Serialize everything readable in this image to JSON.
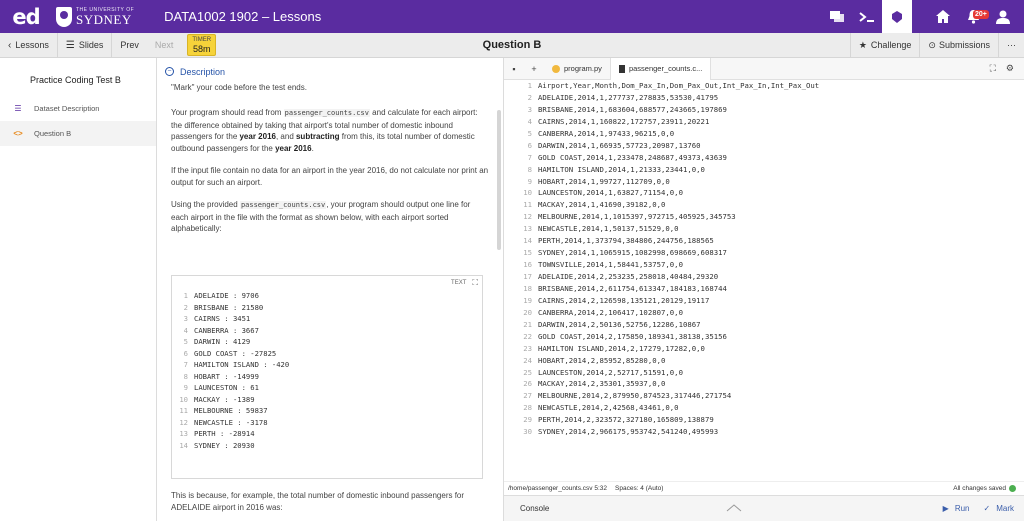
{
  "topbar": {
    "logo": "ed",
    "brand_sub": "THE UNIVERSITY OF",
    "brand_main": "SYDNEY",
    "course": "DATA1002 1902 – Lessons",
    "notif_count": "20+"
  },
  "nav": {
    "lessons": "Lessons",
    "slides": "Slides",
    "prev": "Prev",
    "next": "Next",
    "timer_label": "TIMER",
    "timer_value": "58m",
    "question_title": "Question B",
    "challenge": "Challenge",
    "submissions": "Submissions",
    "more": "···"
  },
  "sidebar": {
    "title": "Practice Coding Test B",
    "items": [
      {
        "label": "Dataset Description"
      },
      {
        "label": "Question B"
      }
    ]
  },
  "description": {
    "header": "Description",
    "cut_line": "\"Mark\" your code before the test ends.",
    "p1_a": "Your program should read from ",
    "p1_code": "passenger_counts.csv",
    "p1_b": " and calculate for each airport: the difference obtained by taking that airport's total number of domestic inbound passengers for the ",
    "p1_year1": "year 2016",
    "p1_c": ", and ",
    "p1_sub": "subtracting",
    "p1_d": " from this, its total number of domestic outbound passengers for the ",
    "p1_year2": "year 2016",
    "p1_e": ".",
    "p2": "If the input file contain no data for an airport in the year 2016, do not calculate nor print an output for such an airport.",
    "p3_a": "Using the provided ",
    "p3_code": "passenger_counts.csv",
    "p3_b": ", your program should output one line for each airport in the file with the format as shown below, with each airport sorted alphabetically:",
    "output_label": "TEXT",
    "output_lines": [
      "ADELAIDE : 9706",
      "BRISBANE : 21580",
      "CAIRNS : 3451",
      "CANBERRA : 3667",
      "DARWIN : 4129",
      "GOLD COAST : -27825",
      "HAMILTON ISLAND : -420",
      "HOBART : -14999",
      "LAUNCESTON : 61",
      "MACKAY : -1389",
      "MELBOURNE : 59837",
      "NEWCASTLE : -3178",
      "PERTH : -28914",
      "SYDNEY : 20930"
    ],
    "after": "This is because, for example, the total number of domestic inbound passengers for ADELAIDE airport in 2016 was:"
  },
  "editor": {
    "tab_file1": "program.py",
    "tab_file2": "passenger_counts.c...",
    "lines": [
      "Airport,Year,Month,Dom_Pax_In,Dom_Pax_Out,Int_Pax_In,Int_Pax_Out",
      "ADELAIDE,2014,1,277737,278835,53530,41795",
      "BRISBANE,2014,1,683604,688577,243665,197869",
      "CAIRNS,2014,1,160822,172757,23911,20221",
      "CANBERRA,2014,1,97433,96215,0,0",
      "DARWIN,2014,1,66935,57723,20987,13760",
      "GOLD COAST,2014,1,233478,248687,49373,43639",
      "HAMILTON ISLAND,2014,1,21333,23441,0,0",
      "HOBART,2014,1,99727,112709,0,0",
      "LAUNCESTON,2014,1,63827,71154,0,0",
      "MACKAY,2014,1,41690,39182,0,0",
      "MELBOURNE,2014,1,1015397,972715,405925,345753",
      "NEWCASTLE,2014,1,50137,51529,0,0",
      "PERTH,2014,1,373794,384806,244756,188565",
      "SYDNEY,2014,1,1065915,1082998,698669,608317",
      "TOWNSVILLE,2014,1,58441,53757,0,0",
      "ADELAIDE,2014,2,253235,258018,40484,29320",
      "BRISBANE,2014,2,611754,613347,184183,168744",
      "CAIRNS,2014,2,126598,135121,20129,19117",
      "CANBERRA,2014,2,106417,102807,0,0",
      "DARWIN,2014,2,50136,52756,12286,10867",
      "GOLD COAST,2014,2,175850,189341,38138,35156",
      "HAMILTON ISLAND,2014,2,17279,17282,0,0",
      "HOBART,2014,2,85952,85280,0,0",
      "LAUNCESTON,2014,2,52717,51591,0,0",
      "MACKAY,2014,2,35301,35937,0,0",
      "MELBOURNE,2014,2,879950,874523,317446,271754",
      "NEWCASTLE,2014,2,42568,43461,0,0",
      "PERTH,2014,2,323572,327180,165809,138879",
      "SYDNEY,2014,2,966175,953742,541240,495993"
    ],
    "status_path": "/home/passenger_counts.csv 5:32",
    "status_spaces": "Spaces: 4 (Auto)",
    "status_saved": "All changes saved",
    "console": "Console",
    "run": "Run",
    "mark": "Mark"
  }
}
